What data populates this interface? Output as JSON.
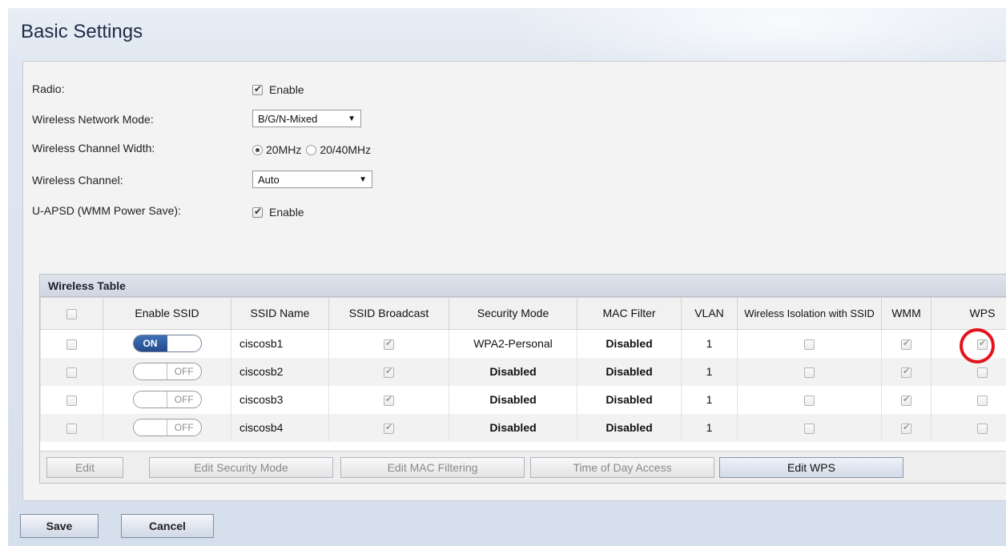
{
  "page": {
    "title": "Basic Settings"
  },
  "settings": {
    "radio": {
      "label": "Radio:",
      "checked": true,
      "option": "Enable"
    },
    "network_mode": {
      "label": "Wireless Network Mode:",
      "value": "B/G/N-Mixed"
    },
    "channel_width": {
      "label": "Wireless Channel Width:",
      "options": [
        "20MHz",
        "20/40MHz"
      ],
      "selected": "20MHz"
    },
    "channel": {
      "label": "Wireless Channel:",
      "value": "Auto"
    },
    "uapsd": {
      "label": "U-APSD (WMM Power Save):",
      "checked": true,
      "option": "Enable"
    }
  },
  "wireless_table": {
    "title": "Wireless Table",
    "headers": [
      "",
      "Enable SSID",
      "SSID Name",
      "SSID Broadcast",
      "Security Mode",
      "MAC Filter",
      "VLAN",
      "Wireless Isolation with SSID",
      "WMM",
      "WPS"
    ],
    "rows": [
      {
        "enable": "ON",
        "ssid": "ciscosb1",
        "broadcast": true,
        "security": "WPA2-Personal",
        "mac_filter": "Disabled",
        "vlan": "1",
        "isolation": false,
        "wmm": true,
        "wps": true
      },
      {
        "enable": "OFF",
        "ssid": "ciscosb2",
        "broadcast": true,
        "security": "Disabled",
        "mac_filter": "Disabled",
        "vlan": "1",
        "isolation": false,
        "wmm": true,
        "wps": false
      },
      {
        "enable": "OFF",
        "ssid": "ciscosb3",
        "broadcast": true,
        "security": "Disabled",
        "mac_filter": "Disabled",
        "vlan": "1",
        "isolation": false,
        "wmm": true,
        "wps": false
      },
      {
        "enable": "OFF",
        "ssid": "ciscosb4",
        "broadcast": true,
        "security": "Disabled",
        "mac_filter": "Disabled",
        "vlan": "1",
        "isolation": false,
        "wmm": true,
        "wps": false
      }
    ],
    "buttons": [
      "Edit",
      "Edit Security Mode",
      "Edit MAC Filtering",
      "Time of Day Access",
      "Edit WPS"
    ]
  },
  "actions": {
    "save": "Save",
    "cancel": "Cancel"
  },
  "colors": {
    "toggle_on": "#2f5c9f",
    "highlight": "#e4121b"
  }
}
